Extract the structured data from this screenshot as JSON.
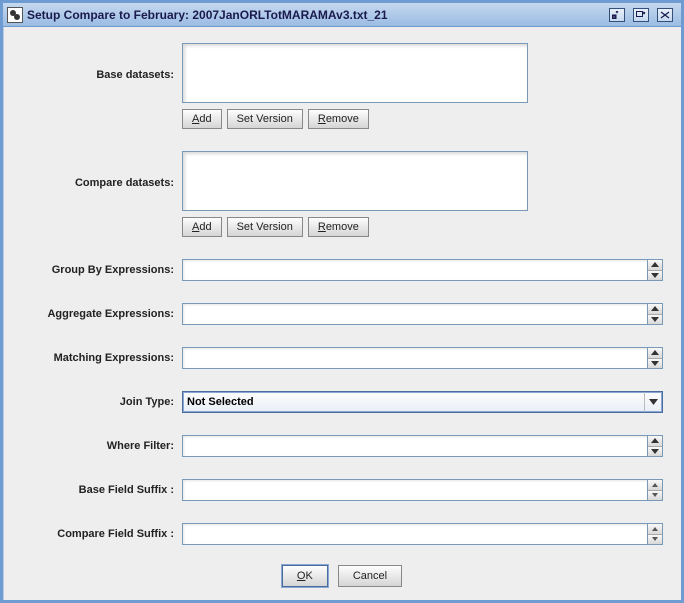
{
  "window": {
    "title": "Setup Compare to February: 2007JanORLTotMARAMAv3.txt_21"
  },
  "labels": {
    "base_datasets": "Base datasets:",
    "compare_datasets": "Compare datasets:",
    "group_by": "Group By Expressions:",
    "aggregate": "Aggregate Expressions:",
    "matching": "Matching Expressions:",
    "join_type": "Join Type:",
    "where_filter": "Where Filter:",
    "base_suffix": "Base Field Suffix :",
    "compare_suffix": "Compare Field Suffix :"
  },
  "buttons": {
    "add_pre": "A",
    "add_post": "dd",
    "set_version": "Set Version",
    "remove_pre": "R",
    "remove_post": "emove",
    "ok_pre": "O",
    "ok_post": "K",
    "cancel": "Cancel"
  },
  "values": {
    "group_by": "",
    "aggregate": "",
    "matching": "",
    "join_type": "Not Selected",
    "where_filter": "",
    "base_suffix": "",
    "compare_suffix": ""
  }
}
